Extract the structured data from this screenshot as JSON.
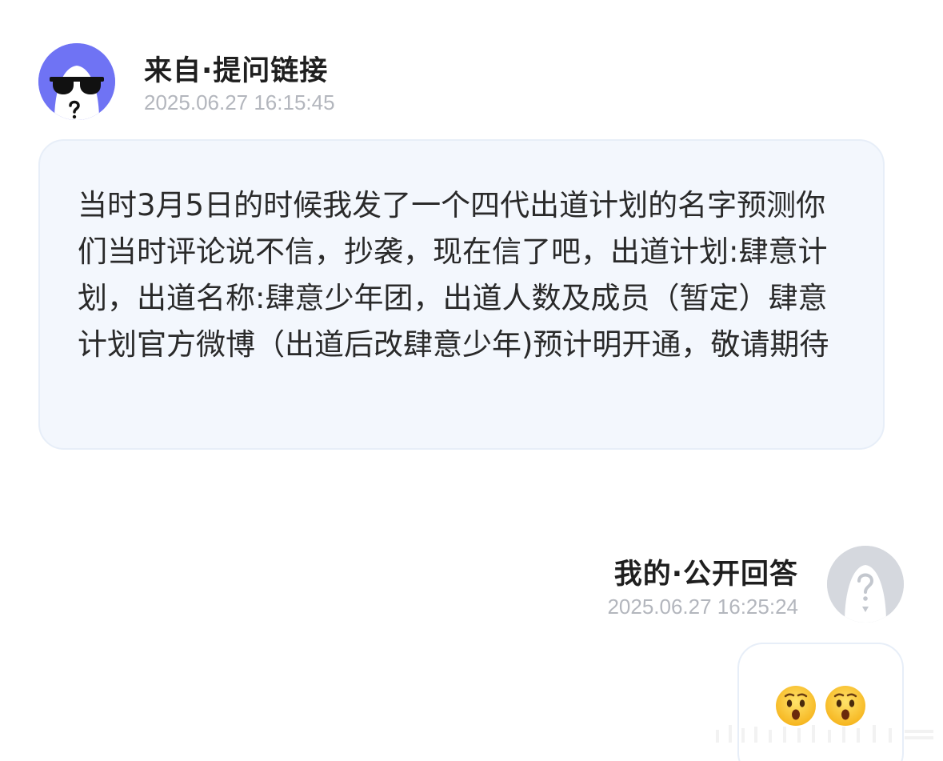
{
  "question": {
    "sender": "来自·提问链接",
    "timestamp": "2025.06.27 16:15:45",
    "avatar_icon": "sunglasses-question-avatar-icon",
    "text": "当时3月5日的时候我发了一个四代出道计划的名字预测你们当时评论说不信，抄袭，现在信了吧，出道计划:肆意计划，出道名称:肆意少年团，出道人数及成员（暂定）肆意计划官方微博（出道后改肆意少年)预计明开通，敬请期待"
  },
  "answer": {
    "sender": "我的·公开回答",
    "timestamp": "2025.06.27 16:25:24",
    "avatar_icon": "question-mark-avatar-icon",
    "emojis": [
      "hushed-face-emoji",
      "hushed-face-emoji"
    ]
  },
  "colors": {
    "question_avatar_bg": "#6f73f4",
    "answer_avatar_bg": "#d5d8de",
    "bubble_bg": "#f3f7fd",
    "timestamp": "#b3b6bd"
  }
}
